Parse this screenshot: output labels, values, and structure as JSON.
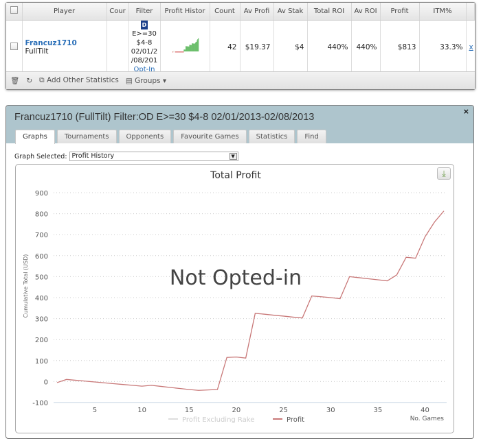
{
  "grid": {
    "columns": [
      "",
      "Player",
      "Cour",
      "Filter",
      "Profit Histor",
      "Count",
      "Av Profi",
      "Av Stak",
      "Total ROI",
      "Av ROI",
      "Profit",
      "ITM%",
      ""
    ],
    "row": {
      "player": "Francuz1710",
      "site": "FullTilt",
      "filter_badge": "D",
      "filter_lines": [
        "E>=30",
        "$4-8",
        "02/01/2",
        "/08/201"
      ],
      "filter_link": "Opt-In",
      "count": "42",
      "av_profit": "$19.37",
      "av_stake": "$4",
      "total_roi": "440%",
      "av_roi": "440%",
      "profit": "$813",
      "itm": "33.3%",
      "remove": "x"
    },
    "footer": {
      "add_stats": "Add Other Statistics",
      "groups": "Groups"
    }
  },
  "panel": {
    "title": "Francuz1710 (FullTilt) Filter:OD E>=30 $4-8 02/01/2013-02/08/2013",
    "close": "×",
    "tabs": [
      "Graphs",
      "Tournaments",
      "Opponents",
      "Favourite Games",
      "Statistics",
      "Find"
    ],
    "active_tab": "Graphs",
    "graph_selected_label": "Graph Selected:",
    "graph_selected_value": "Profit History"
  },
  "chart_data": {
    "type": "line",
    "title": "Total Profit",
    "overlay": "Not Opted-in",
    "xlabel": "No. Games",
    "ylabel": "Cumulative Total (USD)",
    "xlim": [
      1,
      42
    ],
    "ylim": [
      -100,
      900
    ],
    "xticks": [
      5,
      10,
      15,
      20,
      25,
      30,
      35,
      40
    ],
    "yticks": [
      -100,
      0,
      100,
      200,
      300,
      400,
      500,
      600,
      700,
      800,
      900
    ],
    "grid": true,
    "legend_position": "bottom",
    "x": [
      1,
      2,
      3,
      4,
      5,
      6,
      7,
      8,
      9,
      10,
      11,
      12,
      13,
      14,
      15,
      16,
      17,
      18,
      19,
      20,
      21,
      22,
      23,
      24,
      25,
      26,
      27,
      28,
      29,
      30,
      31,
      32,
      33,
      34,
      35,
      36,
      37,
      38,
      39,
      40,
      41,
      42
    ],
    "series": [
      {
        "name": "Profit Excluding Rake",
        "color": "#dddddd",
        "values": []
      },
      {
        "name": "Profit",
        "color": "#c87777",
        "values": [
          -5,
          10,
          6,
          2,
          -2,
          -6,
          -10,
          -14,
          -18,
          -22,
          -18,
          -23,
          -28,
          -33,
          -38,
          -42,
          -40,
          -38,
          115,
          117,
          112,
          325,
          321,
          316,
          312,
          307,
          303,
          408,
          404,
          400,
          395,
          500,
          495,
          490,
          485,
          480,
          508,
          592,
          588,
          690,
          760,
          813
        ]
      }
    ]
  }
}
